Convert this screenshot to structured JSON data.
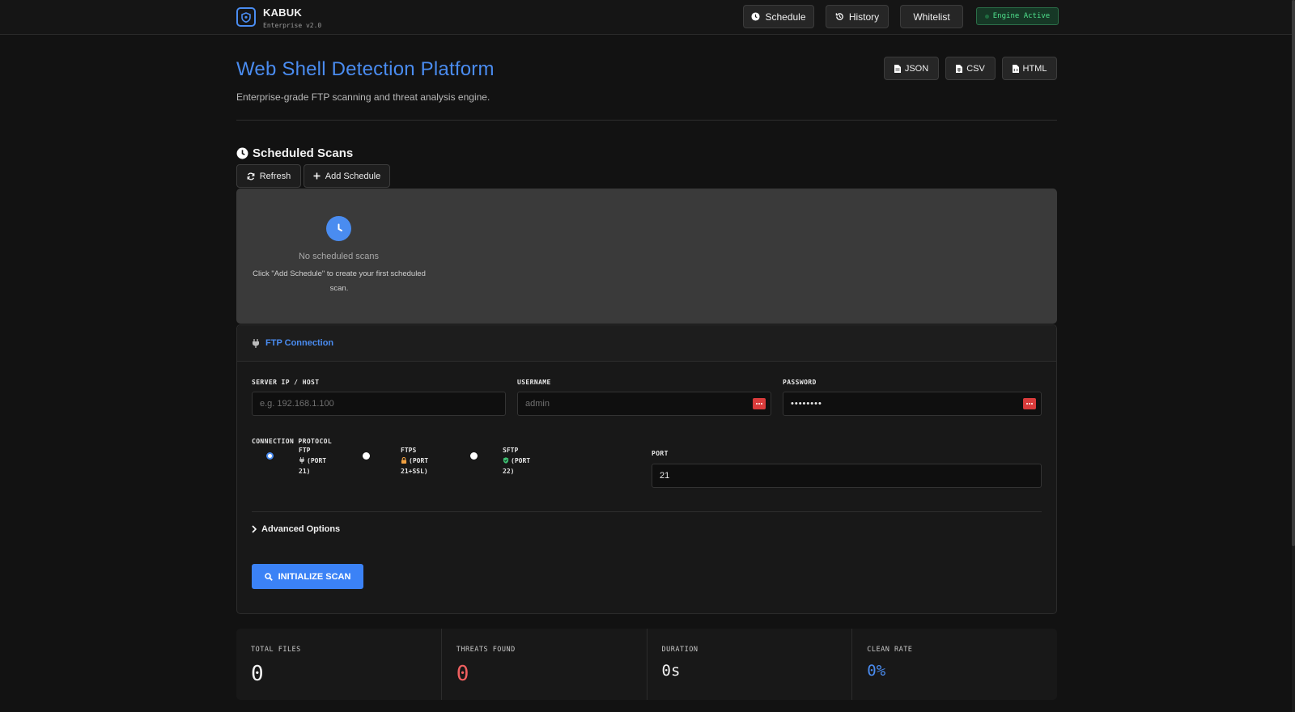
{
  "brand": {
    "name": "KABUK",
    "sub": "Enterprise v2.0"
  },
  "nav": {
    "schedule": "Schedule",
    "history": "History",
    "whitelist": "Whitelist",
    "engine_status": "Engine Active"
  },
  "header": {
    "title": "Web Shell Detection Platform",
    "subtitle": "Enterprise-grade FTP scanning and threat analysis engine.",
    "exports": {
      "json": "JSON",
      "csv": "CSV",
      "html": "HTML"
    }
  },
  "schedule": {
    "title": "Scheduled Scans",
    "refresh": "Refresh",
    "add": "Add Schedule",
    "empty_title": "No scheduled scans",
    "empty_sub": "Click \"Add Schedule\" to create your first scheduled scan."
  },
  "ftp": {
    "heading": "FTP Connection",
    "server_label": "SERVER IP / HOST",
    "server_placeholder": "e.g. 192.168.1.100",
    "server_value": "",
    "username_label": "USERNAME",
    "username_placeholder": "admin",
    "username_value": "",
    "password_label": "PASSWORD",
    "password_value": "••••••••",
    "protocol_label": "CONNECTION PROTOCOL",
    "protocols": [
      {
        "name": "FTP",
        "detail": "(PORT 21)",
        "selected": true
      },
      {
        "name": "FTPS",
        "detail": "(PORT 21+SSL)",
        "selected": false
      },
      {
        "name": "SFTP",
        "detail": "(PORT 22)",
        "selected": false
      }
    ],
    "port_label": "PORT",
    "port_value": "21",
    "advanced": "Advanced Options",
    "init_button": "INITIALIZE SCAN"
  },
  "stats": [
    {
      "label": "TOTAL FILES",
      "value": "0",
      "color": "#f2f2f2"
    },
    {
      "label": "THREATS FOUND",
      "value": "0",
      "color": "#f06060"
    },
    {
      "label": "DURATION",
      "value": "0s",
      "color": "#f2f2f2"
    },
    {
      "label": "CLEAN RATE",
      "value": "0%",
      "color": "#4a8cf0"
    }
  ],
  "colors": {
    "accent": "#4a8cf0",
    "primary_button": "#3b82f6",
    "danger": "#f06060",
    "success": "#4fe08c"
  }
}
